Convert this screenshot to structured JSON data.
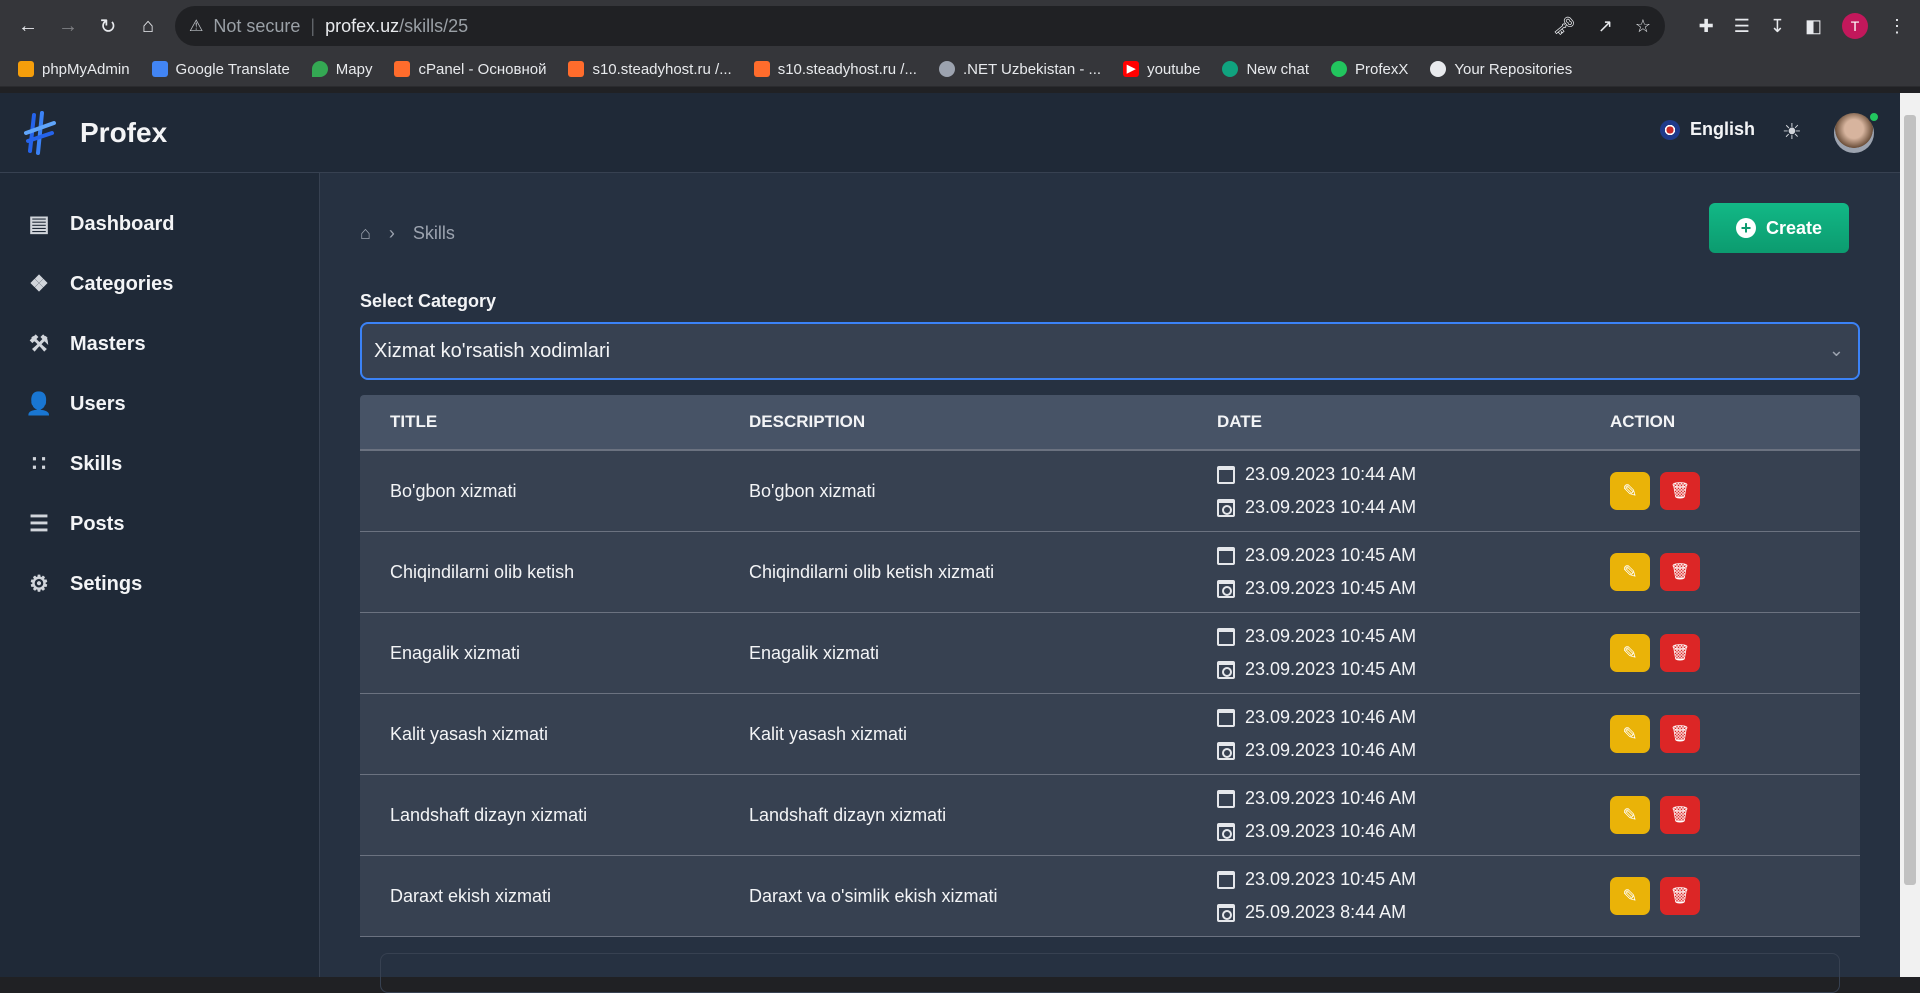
{
  "browser": {
    "security_label": "Not secure",
    "url_host": "profex.uz",
    "url_path": "/skills/25",
    "profile_initial": "T",
    "bookmarks": [
      {
        "label": "phpMyAdmin",
        "color": "#f59e0b"
      },
      {
        "label": "Google Translate",
        "color": "#4285f4"
      },
      {
        "label": "Mapy",
        "color": "#34a853"
      },
      {
        "label": "cPanel - Основной",
        "color": "#ff6c2c"
      },
      {
        "label": "s10.steadyhost.ru /...",
        "color": "#ff6c2c"
      },
      {
        "label": "s10.steadyhost.ru /...",
        "color": "#ff6c2c"
      },
      {
        "label": ".NET Uzbekistan - ...",
        "color": "#9ca3af"
      },
      {
        "label": "youtube",
        "color": "#ff0000"
      },
      {
        "label": "New chat",
        "color": "#10a37f"
      },
      {
        "label": "ProfexX",
        "color": "#22c55e"
      },
      {
        "label": "Your Repositories",
        "color": "#e8eaed"
      }
    ]
  },
  "header": {
    "brand": "Profex",
    "language": "English"
  },
  "sidebar": {
    "items": [
      {
        "label": "Dashboard",
        "icon": "dashboard-icon"
      },
      {
        "label": "Categories",
        "icon": "categories-icon"
      },
      {
        "label": "Masters",
        "icon": "hammer-icon"
      },
      {
        "label": "Users",
        "icon": "users-icon"
      },
      {
        "label": "Skills",
        "icon": "skills-icon"
      },
      {
        "label": "Posts",
        "icon": "posts-icon"
      },
      {
        "label": "Setings",
        "icon": "gear-icon"
      }
    ]
  },
  "main": {
    "breadcrumb": "Skills",
    "create_label": "Create",
    "category_label": "Select Category",
    "category_selected": "Xizmat ko'rsatish xodimlari",
    "table": {
      "headers": [
        "TITLE",
        "DESCRIPTION",
        "DATE",
        "ACTION"
      ],
      "rows": [
        {
          "title": "Bo'gbon xizmati",
          "description": "Bo'gbon xizmati",
          "created": "23.09.2023 10:44 AM",
          "updated": "23.09.2023 10:44 AM"
        },
        {
          "title": "Chiqindilarni olib ketish",
          "description": "Chiqindilarni olib ketish xizmati",
          "created": "23.09.2023 10:45 AM",
          "updated": "23.09.2023 10:45 AM"
        },
        {
          "title": "Enagalik xizmati",
          "description": "Enagalik xizmati",
          "created": "23.09.2023 10:45 AM",
          "updated": "23.09.2023 10:45 AM"
        },
        {
          "title": "Kalit yasash xizmati",
          "description": "Kalit yasash xizmati",
          "created": "23.09.2023 10:46 AM",
          "updated": "23.09.2023 10:46 AM"
        },
        {
          "title": "Landshaft dizayn xizmati",
          "description": "Landshaft dizayn xizmati",
          "created": "23.09.2023 10:46 AM",
          "updated": "23.09.2023 10:46 AM"
        },
        {
          "title": "Daraxt ekish xizmati",
          "description": "Daraxt va o'simlik ekish xizmati",
          "created": "23.09.2023 10:45 AM",
          "updated": "25.09.2023 8:44 AM"
        }
      ]
    }
  },
  "colors": {
    "accent": "#3b82f6",
    "create": "#10a37f",
    "edit": "#eab308",
    "delete": "#dc2626"
  }
}
